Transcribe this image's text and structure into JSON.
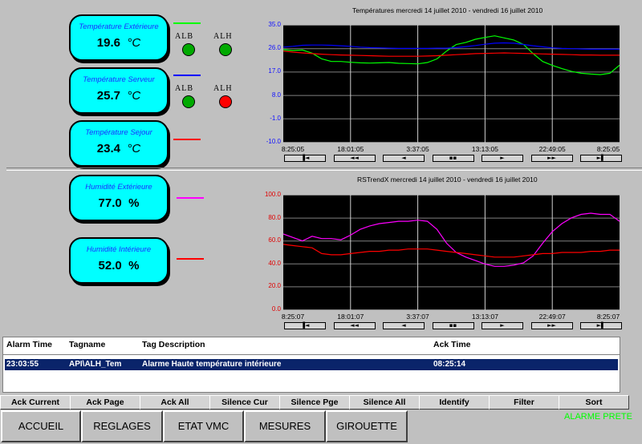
{
  "sensors": [
    {
      "label": "Température Extérieure",
      "value": "19.6",
      "unit": "°C",
      "legend_color": "#00ff00"
    },
    {
      "label": "Température Serveur",
      "value": "25.7",
      "unit": "°C",
      "legend_color": "#0000ff"
    },
    {
      "label": "Température Sejour",
      "value": "23.4",
      "unit": "°C",
      "legend_color": "#ff0000"
    },
    {
      "label": "Humidité Extérieure",
      "value": "77.0",
      "unit": "%",
      "legend_color": "#ff00ff"
    },
    {
      "label": "Humidité Intérieure",
      "value": "52.0",
      "unit": "%",
      "legend_color": "#ff0000"
    }
  ],
  "alarm_labels": {
    "low": "ALB",
    "high": "ALH"
  },
  "leds": {
    "ext_alb": "#00aa00",
    "ext_alh": "#00aa00",
    "srv_alb": "#00aa00",
    "srv_alh": "#ff0000"
  },
  "nav_buttons": [
    "▐◄",
    "◄◄",
    "◄",
    "▪▪",
    "►",
    "►►",
    "►▌"
  ],
  "temp_chart_title": "Températures      mercredi 14 juillet 2010 - vendredi 16 juillet 2010",
  "hum_chart_title": "RSTrendX      mercredi 14 juillet 2010 - vendredi 16 juillet 2010",
  "chart_data": [
    {
      "type": "line",
      "title": "Températures      mercredi 14 juillet 2010 - vendredi 16 juillet 2010",
      "ylim": [
        -10.0,
        35.0
      ],
      "y_ticks": [
        "35.0",
        "26.0",
        "17.0",
        "8.0",
        "-1.0",
        "-10.0"
      ],
      "x_ticks": [
        "8:25:05",
        "18:01:05",
        "3:37:05",
        "13:13:05",
        "22:49:05",
        "8:25:05"
      ],
      "grid": true,
      "series": [
        {
          "color": "#00ff00",
          "values": [
            25.5,
            25.2,
            25.4,
            24.2,
            22,
            21,
            21,
            20.7,
            20.5,
            20.4,
            20.5,
            20.6,
            20.3,
            20.2,
            20.1,
            20.6,
            22,
            25,
            27.5,
            28.3,
            29.5,
            30.2,
            30.8,
            30,
            29.2,
            27.5,
            24,
            21,
            19.5,
            18.3,
            17.2,
            16.5,
            16.2,
            16,
            16.5,
            19.6
          ]
        },
        {
          "color": "#0000ff",
          "values": [
            26.5,
            26.8,
            27.2,
            27.3,
            27.3,
            27.2,
            27.0,
            26.8,
            26.5,
            26.3,
            26.2,
            26.1,
            26.0,
            26.0,
            26.0,
            26.0,
            26.1,
            26.1,
            26.3,
            26.7,
            27.1,
            27.6,
            28.0,
            28.1,
            28.0,
            27.5,
            27.0,
            26.6,
            26.2,
            26.0,
            25.9,
            25.8,
            25.7,
            25.7,
            25.7,
            25.7
          ]
        },
        {
          "color": "#ff0000",
          "values": [
            25.0,
            24.6,
            24.3,
            24.0,
            23.8,
            23.6,
            23.5,
            23.4,
            23.3,
            23.2,
            23.1,
            23.0,
            23.0,
            23.0,
            23.0,
            23.1,
            23.2,
            23.4,
            23.6,
            23.8,
            24.0,
            24.1,
            24.2,
            24.3,
            24.2,
            24.1,
            24.0,
            23.9,
            23.8,
            23.7,
            23.6,
            23.5,
            23.5,
            23.4,
            23.4,
            23.4
          ]
        }
      ]
    },
    {
      "type": "line",
      "title": "RSTrendX      mercredi 14 juillet 2010 - vendredi 16 juillet 2010",
      "ylim": [
        0.0,
        100.0
      ],
      "y_ticks": [
        "100.0",
        "80.0",
        "60.0",
        "40.0",
        "20.0",
        "0.0"
      ],
      "x_ticks": [
        "8:25:07",
        "18:01:07",
        "3:37:07",
        "13:13:07",
        "22:49:07",
        "8:25:07"
      ],
      "grid": true,
      "series": [
        {
          "color": "#ff00ff",
          "values": [
            66,
            63,
            60,
            64,
            62,
            62,
            61,
            65,
            70,
            73,
            75,
            76,
            77,
            77,
            78,
            77,
            70,
            58,
            50,
            46,
            43,
            40,
            38,
            38,
            39,
            41,
            47,
            58,
            68,
            75,
            80,
            83,
            84,
            83,
            83,
            77
          ]
        },
        {
          "color": "#ff0000",
          "values": [
            57,
            56,
            55,
            54,
            49,
            48,
            48,
            49,
            50,
            51,
            51,
            52,
            52,
            53,
            53,
            53,
            52,
            51,
            50,
            49,
            48,
            47,
            46,
            46,
            46,
            47,
            48,
            49,
            49,
            50,
            50,
            50,
            51,
            51,
            52,
            52
          ]
        }
      ]
    }
  ],
  "alarm_table": {
    "headers": [
      "Alarm Time",
      "Tagname",
      "Tag Description",
      "Ack Time"
    ],
    "rows": [
      [
        "23:03:55",
        "API\\ALH_Tem",
        "Alarme Haute température intérieure",
        "08:25:14"
      ]
    ]
  },
  "toolbar": [
    "Ack Current",
    "Ack Page",
    "Ack All",
    "Silence Cur",
    "Silence Pge",
    "Silence All",
    "Identify",
    "Filter",
    "Sort"
  ],
  "menu": [
    "ACCUEIL",
    "REGLAGES",
    "ETAT VMC",
    "MESURES",
    "GIROUETTE"
  ],
  "status_text": "ALARME PRETE"
}
